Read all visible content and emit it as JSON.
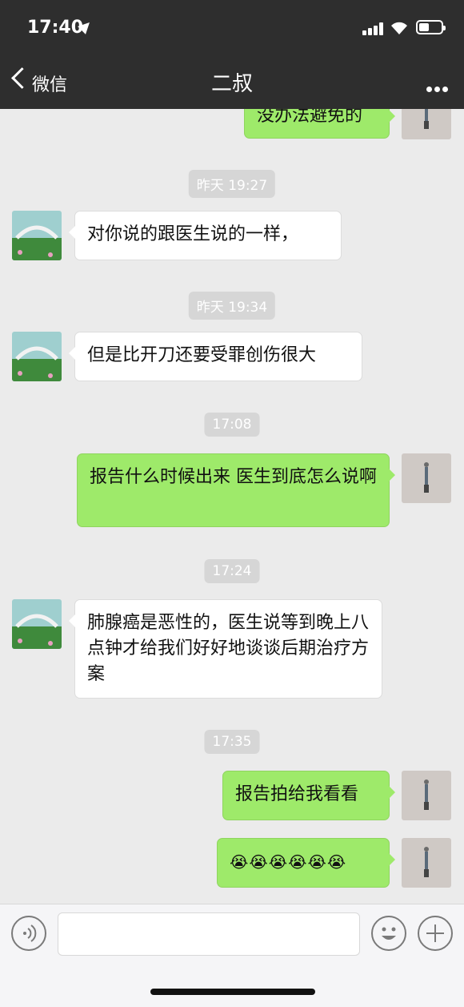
{
  "status_bar": {
    "time": "17:40"
  },
  "nav": {
    "back_label": "微信",
    "title": "二叔"
  },
  "messages": {
    "m0": "没办法避免的",
    "t1": "昨天 19:27",
    "m1": "对你说的跟医生说的一样，",
    "t2": "昨天 19:34",
    "m2": "但是比开刀还要受罪创伤很大",
    "t3": "17:08",
    "m3": "报告什么时候出来 医生到底怎么说啊",
    "t4": "17:24",
    "m4": "肺腺癌是恶性的，医生说等到晚上八点钟才给我们好好地谈谈后期治疗方案",
    "t5": "17:35",
    "m5": "报告拍给我看看",
    "m6": "😭😭😭😭😭😭"
  },
  "colors": {
    "nav_bg": "#2e2e2e",
    "chat_bg": "#ebebeb",
    "outgoing_bubble": "#9eea6a",
    "incoming_bubble": "#ffffff"
  },
  "icons": [
    "back-chevron-icon",
    "more-icon",
    "voice-icon",
    "emoji-icon",
    "plus-icon"
  ]
}
